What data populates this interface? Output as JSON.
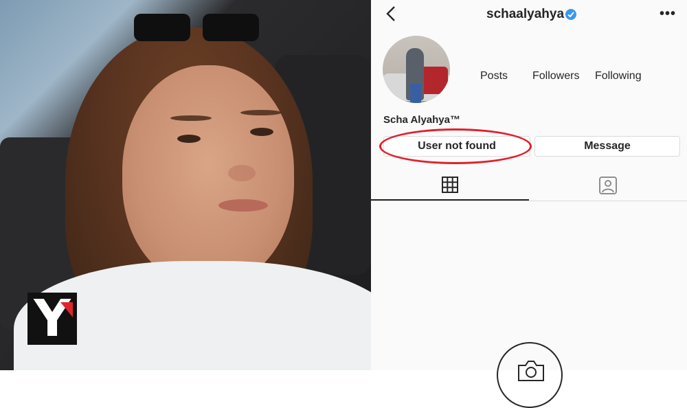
{
  "profile": {
    "username": "schaalyahya",
    "full_name": "Scha Alyahya™",
    "stats": {
      "posts_label": "Posts",
      "followers_label": "Followers",
      "following_label": "Following"
    }
  },
  "buttons": {
    "primary_label": "User not found",
    "message_label": "Message"
  },
  "logo": {
    "letter": "Y"
  },
  "colors": {
    "annotation": "#e3202a",
    "verified": "#3897f0"
  },
  "icons": {
    "back": "chevron-left-icon",
    "more": "more-options-icon",
    "verified": "verified-badge-icon",
    "grid": "grid-icon",
    "tagged": "tagged-user-icon",
    "camera": "camera-icon"
  }
}
